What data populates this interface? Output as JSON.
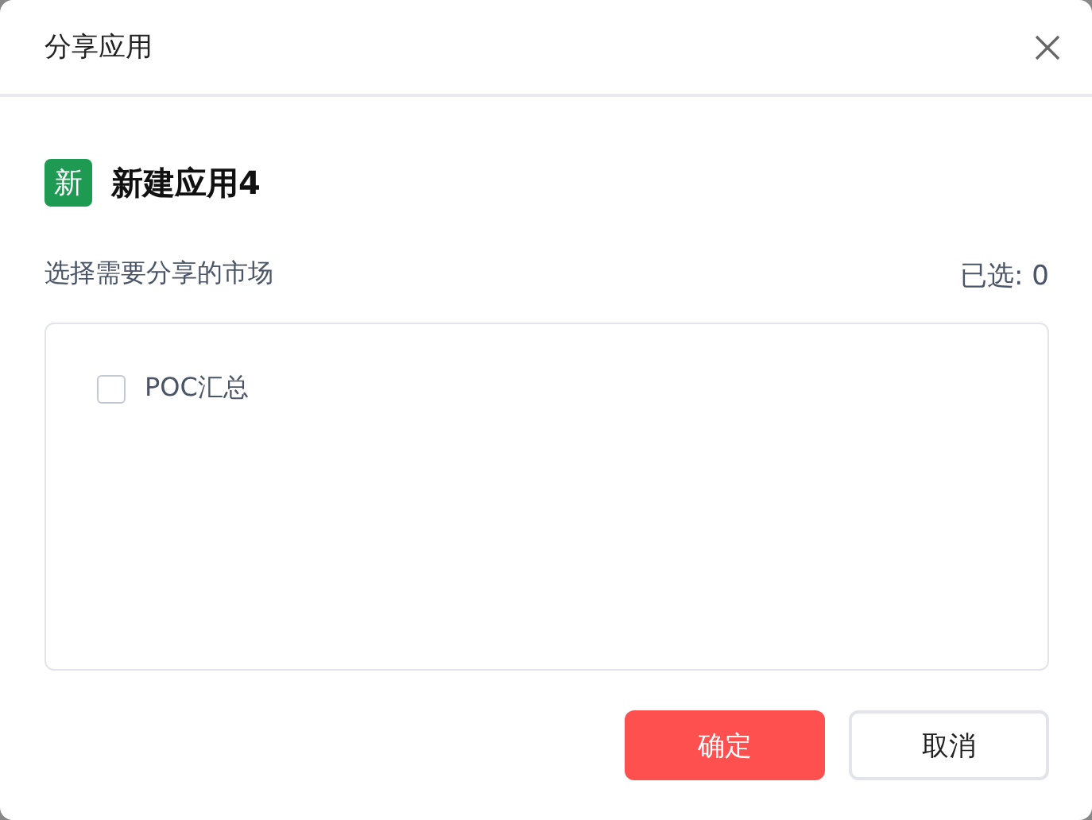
{
  "dialog": {
    "title": "分享应用"
  },
  "app": {
    "badge": "新",
    "name": "新建应用4"
  },
  "markets": {
    "label": "选择需要分享的市场",
    "count": "已选: 0",
    "items": [
      {
        "label": "POC汇总",
        "checked": false
      }
    ]
  },
  "buttons": [
    {
      "label": "确定",
      "kind": "primary"
    },
    {
      "label": "取消",
      "kind": "secondary"
    }
  ]
}
